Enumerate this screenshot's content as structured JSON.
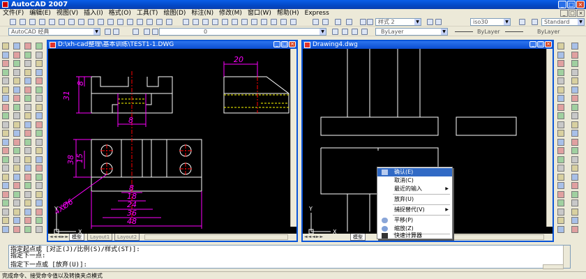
{
  "app": {
    "title": "AutoCAD 2007"
  },
  "menubar": {
    "items": [
      "文件(F)",
      "编辑(E)",
      "视图(V)",
      "插入(I)",
      "格式(O)",
      "工具(T)",
      "绘图(D)",
      "标注(N)",
      "修改(M)",
      "窗口(W)",
      "帮助(H)",
      "Express"
    ]
  },
  "toolbar": {
    "text_style": "样式 2",
    "dim_style": "iso30",
    "table_style": "Standard",
    "workspace": "AutoCAD 经典",
    "layer": "0",
    "color": "ByLayer",
    "linetype": "ByLayer",
    "lineweight": "ByLayer"
  },
  "drawing1": {
    "title": "D:\\xh-cad整理\\基本训练\\TEST1-1.DWG",
    "tabs": [
      "模型",
      "Layout1",
      "Layout2"
    ],
    "dims": {
      "top_width": "20",
      "left_h1": "8",
      "left_h2": "31",
      "slot": "8",
      "right_h1": "38",
      "right_h2": "15",
      "holes": "4XØ6",
      "w1": "8",
      "w2": "18",
      "w3": "24",
      "w4": "36",
      "w5": "48"
    }
  },
  "drawing2": {
    "title": "Drawing4.dwg",
    "tabs": [
      "模型"
    ]
  },
  "context_menu": {
    "items": [
      {
        "label": "确认(E)",
        "highlighted": true
      },
      {
        "label": "取消(C)"
      },
      {
        "label": "最近的输入",
        "submenu": true
      },
      {
        "label": "放弃(U)"
      },
      {
        "label": "捕捉替代(V)",
        "submenu": true
      },
      {
        "label": "平移(P)",
        "icon": "pan-icon"
      },
      {
        "label": "缩放(Z)",
        "icon": "zoom-icon"
      },
      {
        "label": "快速计算器",
        "icon": "calculator-icon"
      }
    ]
  },
  "command": {
    "lines": [
      "指定起点或 [对正(J)/比例(S)/样式(ST)]:",
      "指定下一点:",
      "指定下一点或 [放弃(U)]:"
    ]
  },
  "status": {
    "text": "完成命令、接受命令值以及转换夹点模式"
  },
  "colors": {
    "accent": "#0a55d8",
    "dim": "#ff00ff",
    "center": "#ff0000",
    "hidden": "#ffff00",
    "line": "#ffffff"
  }
}
